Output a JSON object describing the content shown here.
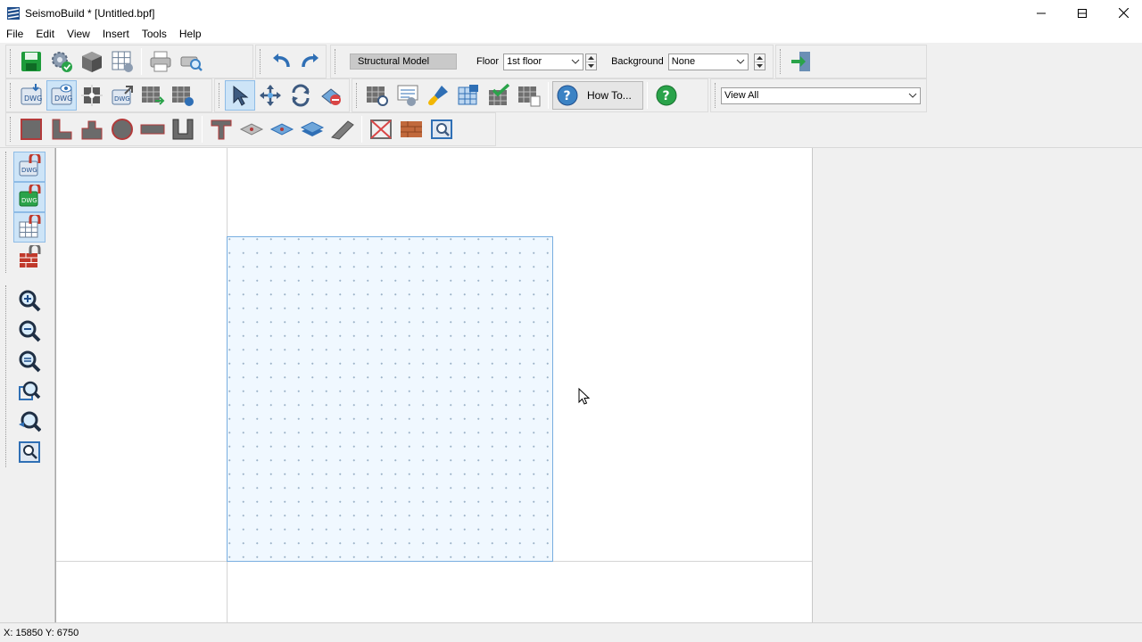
{
  "window": {
    "title": "SeismoBuild * [Untitled.bpf]",
    "minimize_icon": "minimize-icon",
    "maximize_icon": "maximize-icon",
    "close_icon": "close-icon"
  },
  "menu": [
    "File",
    "Edit",
    "View",
    "Insert",
    "Tools",
    "Help"
  ],
  "toolbar1": {
    "structural_model_label": "Structural Model",
    "floor_label": "Floor",
    "floor_value": "1st floor",
    "background_label": "Background",
    "background_value": "None"
  },
  "toolbar2": {
    "howto_label": "How To...",
    "view_value": "View All"
  },
  "status": {
    "coords": "X: 15850  Y: 6750"
  },
  "colors": {
    "accent": "#2f6fb5",
    "floor_outline": "#78aee0",
    "floor_fill": "#f0f8ff",
    "active_button": "#cde4f7"
  }
}
